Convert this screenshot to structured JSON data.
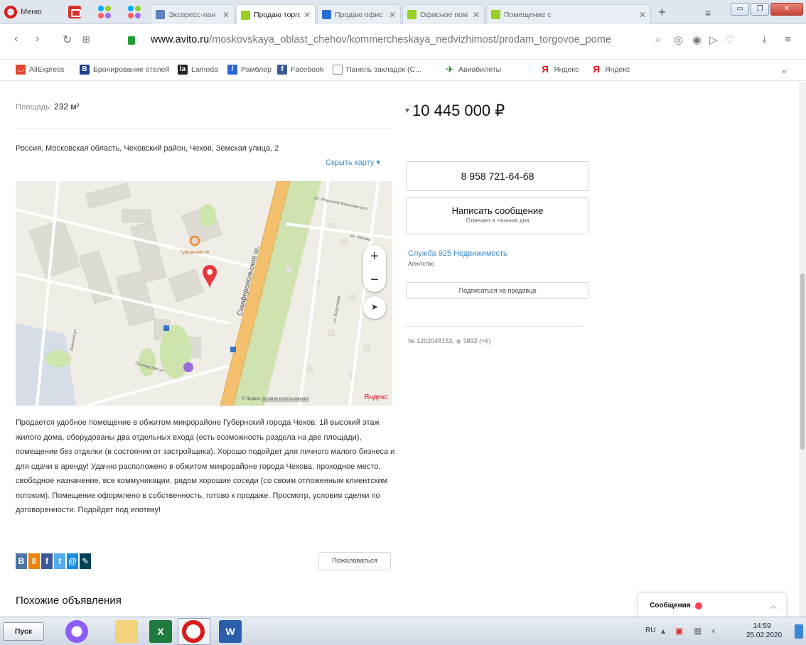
{
  "browser": {
    "menu_label": "Меню",
    "tabs": [
      {
        "label": "Экспресс-пан",
        "fav_color": "#5b7fbf"
      },
      {
        "label": "Продаю торго",
        "fav_color": "#97cf26"
      },
      {
        "label": "Продаю офис",
        "fav_color": "#2b6fd6"
      },
      {
        "label": "Офисное пом",
        "fav_color": "#97cf26"
      },
      {
        "label": "Помещение с",
        "fav_color": "#97cf26"
      }
    ],
    "url_domain": "www.avito.ru",
    "url_path": "/moskovskaya_oblast_chehov/kommercheskaya_nedvizhimost/prodam_torgovoe_pome",
    "bookmarks": [
      {
        "label": "AliExpress",
        "icon": "aliexpress-icon",
        "color": "#e8432e",
        "glyph": "◡"
      },
      {
        "label": "Бронирование отелей",
        "icon": "booking-icon",
        "color": "#1e3f8f",
        "glyph": "B"
      },
      {
        "label": "Lamoda",
        "icon": "lamoda-icon",
        "color": "#222222",
        "glyph": "la"
      },
      {
        "label": "Рамблер",
        "icon": "rambler-icon",
        "color": "#2a64d6",
        "glyph": "/"
      },
      {
        "label": "Facebook",
        "icon": "facebook-icon",
        "color": "#3b5998",
        "glyph": "f"
      },
      {
        "label": "Панель закладок (С...",
        "icon": "folder-icon",
        "color": "#ffffff",
        "glyph": "□"
      },
      {
        "label": "Авиабилеты",
        "icon": "plane-icon",
        "color": "#ffffff",
        "glyph": "✈"
      },
      {
        "label": "Яндекс",
        "icon": "yandex-icon",
        "color": "#ffffff",
        "glyph": "Я"
      },
      {
        "label": "Яндекс",
        "icon": "yandex-icon",
        "color": "#ffffff",
        "glyph": "Я"
      }
    ],
    "more": "»"
  },
  "listing": {
    "area_label": "Площадь:",
    "area_value": "232 м²",
    "address": "Россия, Московская область, Чеховский район, Чехов, Земская улица, 2",
    "hide_map": "Скрыть карту",
    "map": {
      "zoom_in": "+",
      "zoom_out": "−",
      "locate": "➤",
      "street_main": "Симферопольское ш.",
      "street_1": "ул. Маршала Василевского",
      "street_2": "ул. Чехова",
      "street_3": "Земская ул.",
      "street_4": "Пионерская ул.",
      "street_5": "ул. Береговая",
      "poi": "Губернский 14",
      "copyright_prefix": "© Яндекс",
      "copyright_link": "Условия использования",
      "logo": "Яндекс"
    },
    "description": "Продается удобное помещение в обжитом микрорайоне Губернский города Чехов. 1й высокий этаж жилого дома, оборудованы два отдельных входа (есть возможность раздела на две площади), помещение без отделки (в состоянии от застройщика). Хорошо подойдет для личного малого бизнеса и для сдачи в аренду! Удачно расположено в обжитом микрорайоне города Чехова, проходное место, свободное назначение, все коммуникации, рядом хорошие соседи (со своим отложенным клиентским потоком). Помещение оформлено в собственность, готово к продаже. Просмотр, условия сделки по договоренности. Подойдет под ипотеку!",
    "share": [
      {
        "name": "vk-share-icon",
        "glyph": "B",
        "color": "#4c75a3"
      },
      {
        "name": "ok-share-icon",
        "glyph": "8",
        "color": "#ee8208"
      },
      {
        "name": "facebook-share-icon",
        "glyph": "f",
        "color": "#3b5998"
      },
      {
        "name": "twitter-share-icon",
        "glyph": "t",
        "color": "#55acee"
      },
      {
        "name": "mailru-share-icon",
        "glyph": "@",
        "color": "#168de2"
      },
      {
        "name": "lj-share-icon",
        "glyph": "✎",
        "color": "#004359"
      }
    ],
    "complain": "Пожаловаться",
    "similar_title": "Похожие объявления",
    "price": "10 445 000 ₽",
    "phone": "8 958 721-64-68",
    "write_message": "Написать сообщение",
    "reply_time": "Отвечает в течение дня",
    "seller_name": "Служба 925 Недвижимость",
    "seller_type": "Агентство",
    "subscribe": "Подписаться на продавца",
    "ad_number": "№ 1202048153,",
    "views": "3892 (+6)"
  },
  "messenger": {
    "title": "Сообщения"
  },
  "taskbar": {
    "start": "Пуск",
    "lang": "RU",
    "time": "14:59",
    "date": "25.02.2020"
  }
}
